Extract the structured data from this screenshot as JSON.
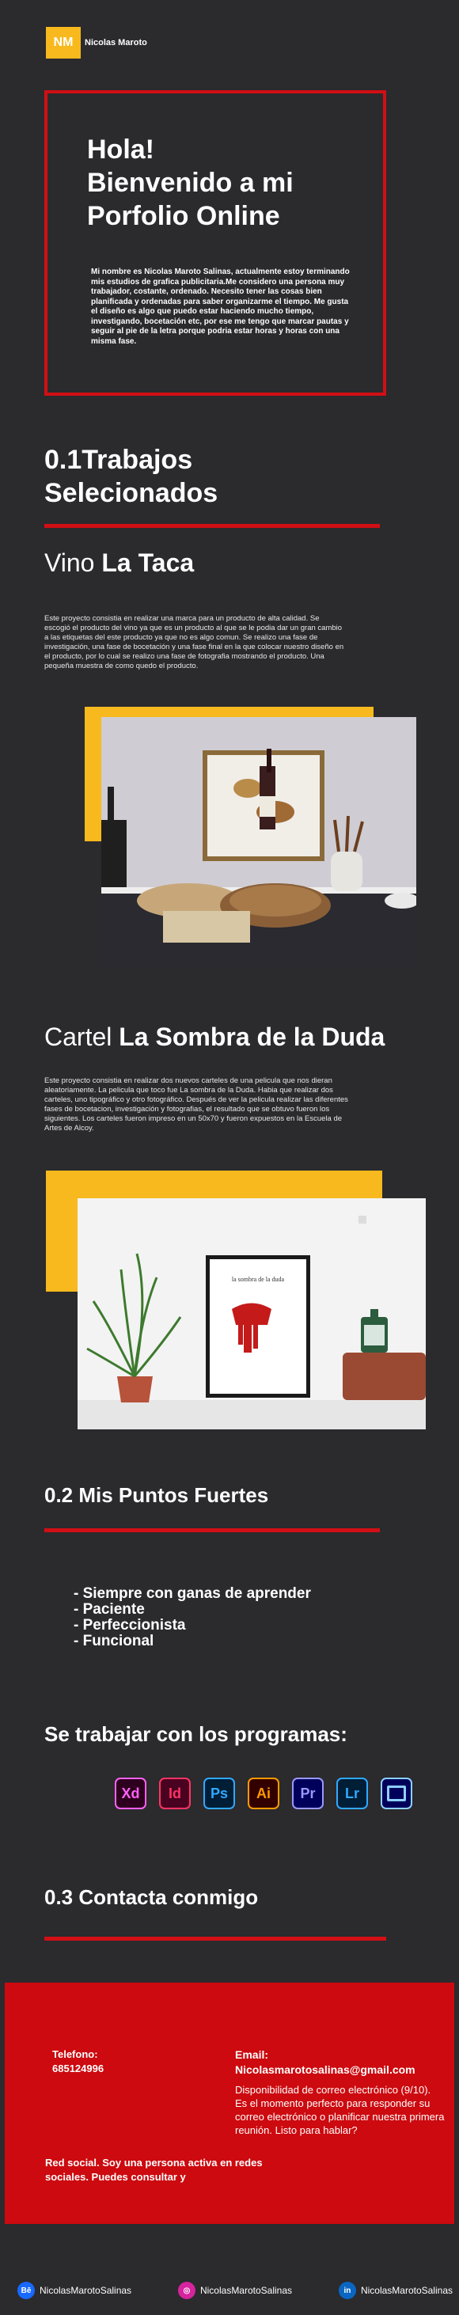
{
  "header": {
    "logo_text": "NM",
    "name": "Nicolas Maroto"
  },
  "hero": {
    "line1": "Hola!",
    "line2": "Bienvenido a mi",
    "line3": "Porfolio Online",
    "text": "Mi nombre es Nicolas Maroto Salinas, actualmente estoy terminando mis estudios de grafica publicitaria.Me considero una persona muy trabajador, costante, ordenado. Necesito tener las cosas bien planificada y ordenadas para saber organizarme el tiempo. Me gusta el diseño es algo que puedo estar haciendo mucho tiempo, investigando, bocetación etc, por ese me tengo que marcar pautas y seguir al pie de la letra porque podria estar horas y horas con una misma fase."
  },
  "section1": {
    "title_line1": "0.1Trabajos",
    "title_line2": "Selecionados"
  },
  "project1": {
    "title_prefix": "Vino",
    "title_bold": "La Taca",
    "text": "Este proyecto consistia en realizar una marca para un producto de alta calidad. Se escogió el producto del vino ya que es un producto al que se le podia dar un gran cambio a las etiquetas del este producto ya que no es algo comun. Se realizo una fase de investigación, una fase de bocetación y una fase final en la que colocar nuestro diseño en el producto, por lo cual se realizo una fase de fotografia mostrando el producto. Una pequeña muestra de como quedo el producto."
  },
  "project2": {
    "title_prefix": "Cartel",
    "title_bold": "La Sombra de la Duda",
    "text": "Este proyecto consistia en realizar dos nuevos carteles de una pelicula que nos dieran aleatoriamente. La pelicula que toco fue La sombra de la Duda. Habia que realizar dos carteles, uno tipográfico y otro fotográfico. Después de ver la pelicula realizar las diferentes fases de bocetacion, investigación y fotografias, el resultado que se obtuvo fueron los siguientes. Los carteles fueron impreso en un 50x70 y fueron expuestos en la Escuela de Artes de Alcoy.",
    "poster_text": "la sombra de la duda"
  },
  "section2": {
    "title": "0.2 Mis Puntos Fuertes",
    "items": [
      "- Siempre con ganas de aprender",
      "- Paciente",
      "- Perfeccionista",
      "- Funcional"
    ]
  },
  "programs": {
    "title": "Se trabajar con los programas:",
    "icons": [
      {
        "label": "Xd",
        "name": "adobe-xd-icon",
        "bg": "#2e001f",
        "fg": "#ff61f6"
      },
      {
        "label": "Id",
        "name": "adobe-indesign-icon",
        "bg": "#49021f",
        "fg": "#ff3366"
      },
      {
        "label": "Ps",
        "name": "adobe-photoshop-icon",
        "bg": "#001e36",
        "fg": "#31a8ff"
      },
      {
        "label": "Ai",
        "name": "adobe-illustrator-icon",
        "bg": "#330000",
        "fg": "#ff9a00"
      },
      {
        "label": "Pr",
        "name": "adobe-premiere-icon",
        "bg": "#00005b",
        "fg": "#9999ff"
      },
      {
        "label": "Lr",
        "name": "adobe-lightroom-icon",
        "bg": "#001e36",
        "fg": "#31a8ff"
      },
      {
        "label": "",
        "name": "adobe-media-encoder-icon",
        "bg": "#00005b",
        "fg": "#8cd1ff"
      }
    ]
  },
  "section3": {
    "title": "0.3 Contacta conmigo"
  },
  "contact": {
    "phone_label": "Telefono:",
    "phone": "685124996",
    "email_label": "Email:",
    "email": "Nicolasmarotosalinas@gmail.com",
    "availability": "Disponibilidad de correo electrónico (9/10).\nEs el momento perfecto para responder su correo electrónico o planificar nuestra primera reunión. Listo para hablar?",
    "social": "Red social. Soy una persona activa en redes sociales. Puedes consultar y"
  },
  "footer": {
    "items": [
      {
        "icon": "behance-icon",
        "glyph": "Bē",
        "label": "NicolasMarotoSalinas",
        "color": "#1769ff"
      },
      {
        "icon": "instagram-icon",
        "glyph": "◎",
        "label": "NicolasMarotoSalinas",
        "color": "#d6249f"
      },
      {
        "icon": "linkedin-icon",
        "glyph": "in",
        "label": "NicolasMarotoSalinas",
        "color": "#0a66c2"
      }
    ]
  },
  "colors": {
    "background": "#2b2a2d",
    "accent_red": "#d10f14",
    "accent_yellow": "#f7b91d",
    "contact_red": "#cc0a0f"
  }
}
